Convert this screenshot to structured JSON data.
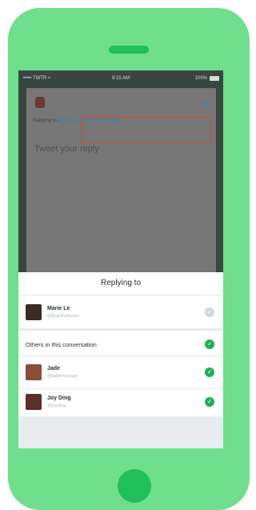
{
  "status_bar": {
    "carrier": "••••• TWTR ≈",
    "time": "9:15 AM",
    "battery": "100%"
  },
  "compose": {
    "close_symbol": "×",
    "replying_prefix": "Replying to ",
    "replying_handles": "@BrandVirtuoso and 2 others",
    "placeholder": "Tweet your reply"
  },
  "sheet": {
    "title": "Replying to",
    "primary": {
      "name": "Marie Le",
      "handle": "@BrandVirtuoso",
      "checked": false
    },
    "others_label": "Others in this conversation",
    "others": [
      {
        "name": "Jade",
        "handle": "@jadeinvoyage",
        "checked": true
      },
      {
        "name": "Joy Ding",
        "handle": "@joyding",
        "checked": true
      }
    ],
    "check_symbol": "✓"
  },
  "colors": {
    "phone_body": "#6fde8d",
    "phone_accent": "#1fc05b",
    "highlight": "#d14b3a",
    "link": "#3f82b0",
    "check": "#1fb057"
  }
}
